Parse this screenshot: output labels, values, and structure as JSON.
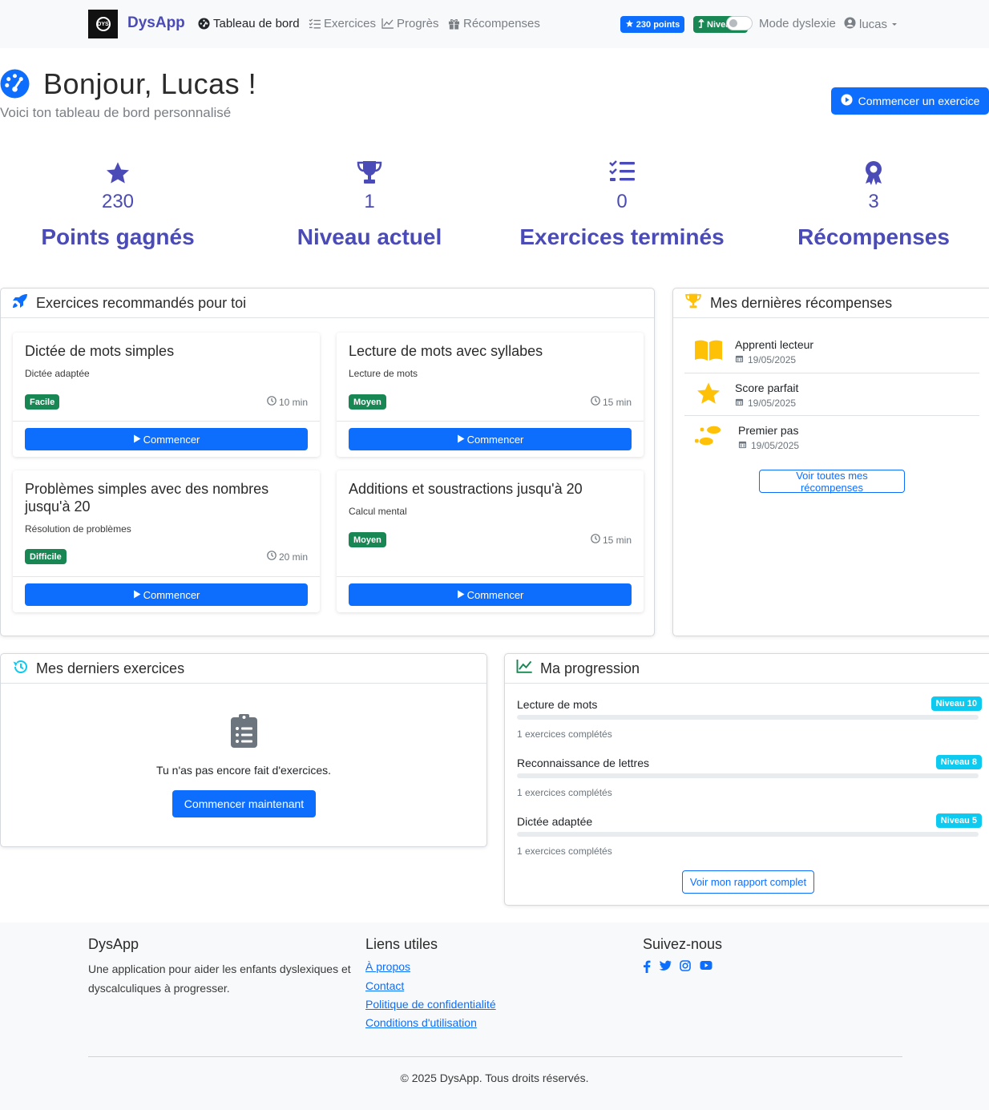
{
  "nav": {
    "logo_text": "DYS",
    "brand": "DysApp",
    "items": [
      {
        "label": "Tableau de bord",
        "icon": "dashboard-icon",
        "active": true
      },
      {
        "label": "Exercices",
        "icon": "list-check-icon",
        "active": false
      },
      {
        "label": "Progrès",
        "icon": "chart-line-icon",
        "active": false
      },
      {
        "label": "Récompenses",
        "icon": "gift-icon",
        "active": false
      }
    ],
    "points_badge": "230 points",
    "level_badge": "Niveau",
    "dyslexia_mode_label": "Mode dyslexie",
    "dyslexia_mode_on": false,
    "user_name": "lucas"
  },
  "header": {
    "title": "Bonjour, Lucas !",
    "subtitle": "Voici ton tableau de bord personnalisé",
    "start_button": "Commencer un exercice"
  },
  "stats": [
    {
      "icon": "star-icon",
      "value": "230",
      "label": "Points gagnés"
    },
    {
      "icon": "trophy-icon",
      "value": "1",
      "label": "Niveau actuel"
    },
    {
      "icon": "list-check-icon",
      "value": "0",
      "label": "Exercices terminés"
    },
    {
      "icon": "award-icon",
      "value": "3",
      "label": "Récompenses"
    }
  ],
  "recommended": {
    "title": "Exercices recommandés pour toi",
    "exercises": [
      {
        "title": "Dictée de mots simples",
        "category": "Dictée adaptée",
        "difficulty": "Facile",
        "duration": "10 min",
        "button": "Commencer"
      },
      {
        "title": "Lecture de mots avec syllabes",
        "category": "Lecture de mots",
        "difficulty": "Moyen",
        "duration": "15 min",
        "button": "Commencer"
      },
      {
        "title": "Problèmes simples avec des nombres jusqu'à 20",
        "category": "Résolution de problèmes",
        "difficulty": "Difficile",
        "duration": "20 min",
        "button": "Commencer"
      },
      {
        "title": "Additions et soustractions jusqu'à 20",
        "category": "Calcul mental",
        "difficulty": "Moyen",
        "duration": "15 min",
        "button": "Commencer"
      }
    ]
  },
  "rewards": {
    "title": "Mes dernières récompenses",
    "items": [
      {
        "name": "Apprenti lecteur",
        "date": "19/05/2025",
        "icon": "book-icon"
      },
      {
        "name": "Score parfait",
        "date": "19/05/2025",
        "icon": "star-icon"
      },
      {
        "name": "Premier pas",
        "date": "19/05/2025",
        "icon": "footprints-icon"
      }
    ],
    "view_all": "Voir toutes mes récompenses"
  },
  "last_exercises": {
    "title": "Mes derniers exercices",
    "empty_text": "Tu n'as pas encore fait d'exercices.",
    "button": "Commencer maintenant"
  },
  "progression": {
    "title": "Ma progression",
    "items": [
      {
        "name": "Lecture de mots",
        "level": "Niveau 10",
        "completed": "1 exercices complétés",
        "progress": 0
      },
      {
        "name": "Reconnaissance de lettres",
        "level": "Niveau 8",
        "completed": "1 exercices complétés",
        "progress": 0
      },
      {
        "name": "Dictée adaptée",
        "level": "Niveau 5",
        "completed": "1 exercices complétés",
        "progress": 0
      }
    ],
    "report_button": "Voir mon rapport complet"
  },
  "footer": {
    "brand": "DysApp",
    "description": "Une application pour aider les enfants dyslexiques et dyscalculiques à progresser.",
    "links_title": "Liens utiles",
    "links": [
      "À propos",
      "Contact",
      "Politique de confidentialité",
      "Conditions d'utilisation"
    ],
    "follow_title": "Suivez-nous",
    "copyright": "© 2025 DysApp. Tous droits réservés."
  },
  "colors": {
    "primary": "#0d6efd",
    "brand_purple": "#4b4bb7",
    "success": "#198754",
    "info": "#0dcaf0",
    "reward_gold": "#ffc107"
  }
}
